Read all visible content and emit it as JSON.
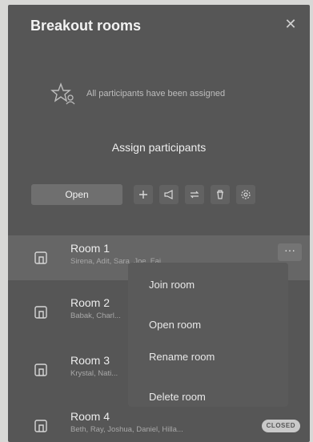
{
  "header": {
    "title": "Breakout rooms",
    "close_glyph": "✕"
  },
  "status": {
    "message": "All participants have been assigned",
    "icon": "star-people-icon"
  },
  "assign": {
    "label": "Assign participants"
  },
  "toolbar": {
    "open_label": "Open",
    "icons": [
      "add-icon",
      "announce-icon",
      "move-icon",
      "delete-icon",
      "settings-icon"
    ]
  },
  "rooms": [
    {
      "name": "Room 1",
      "members": "Sirena, Adit, Sara, Joe, Fai..."
    },
    {
      "name": "Room 2",
      "members": "Babak, Charl..."
    },
    {
      "name": "Room 3",
      "members": "Krystal, Nati..."
    },
    {
      "name": "Room 4",
      "members": "Beth, Ray, Joshua, Daniel, Hilla...",
      "badge": "CLOSED"
    }
  ],
  "context_menu": {
    "items": [
      "Join room",
      "Open room",
      "Rename room",
      "Delete room"
    ]
  },
  "more_glyph": "···"
}
